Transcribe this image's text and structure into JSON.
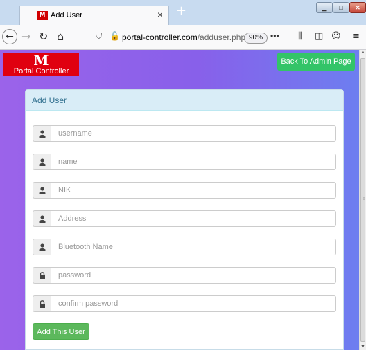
{
  "browser": {
    "tab_title": "Add User",
    "tab_favicon_text": "M",
    "tab_close": "×",
    "new_tab": "+",
    "url_host": "portal-controller.com",
    "url_path": "/adduser.php",
    "zoom": "90%",
    "page_actions": "•••"
  },
  "header": {
    "logo_mark": "M",
    "logo_text": "Portal Controller",
    "back_button": "Back To Admin Page"
  },
  "form": {
    "heading": "Add User",
    "fields": [
      {
        "placeholder": "username",
        "icon": "user-icon"
      },
      {
        "placeholder": "name",
        "icon": "user-icon"
      },
      {
        "placeholder": "NIK",
        "icon": "user-icon"
      },
      {
        "placeholder": "Address",
        "icon": "user-icon"
      },
      {
        "placeholder": "Bluetooth Name",
        "icon": "user-icon"
      },
      {
        "placeholder": "password",
        "icon": "lock-icon"
      },
      {
        "placeholder": "confirm password",
        "icon": "lock-icon"
      }
    ],
    "submit_label": "Add This User"
  },
  "colors": {
    "submit_green": "#5cb85c",
    "admin_green": "#33c468",
    "logo_red": "#e00010",
    "panel_heading_bg": "#d9edf7",
    "panel_heading_text": "#31708f"
  }
}
